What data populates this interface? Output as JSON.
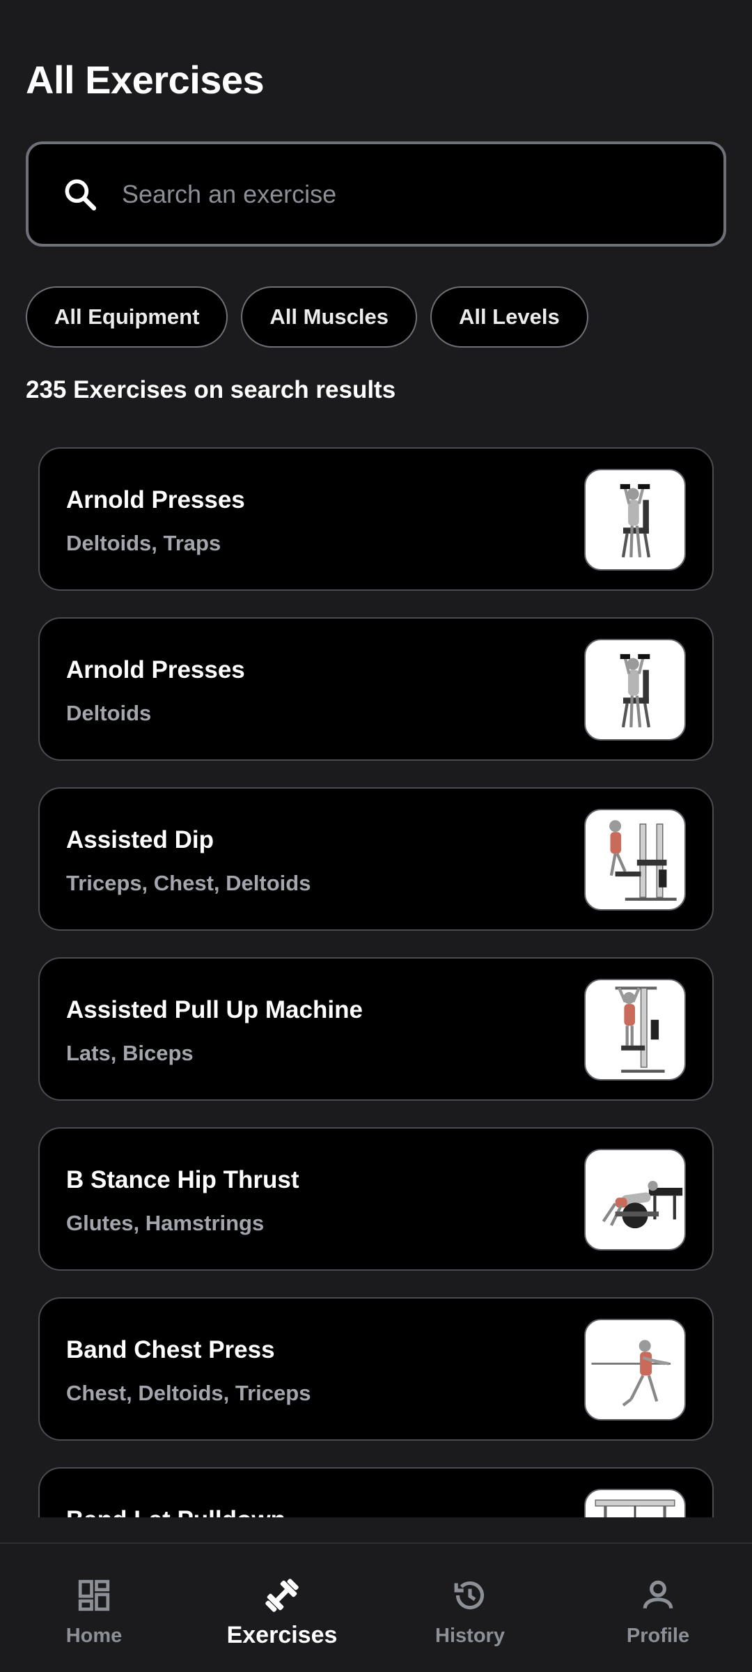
{
  "header": {
    "title": "All Exercises"
  },
  "search": {
    "placeholder": "Search an exercise",
    "value": ""
  },
  "filters": [
    {
      "label": "All Equipment"
    },
    {
      "label": "All Muscles"
    },
    {
      "label": "All Levels"
    }
  ],
  "results": {
    "summary": "235 Exercises on search results"
  },
  "exercises": [
    {
      "name": "Arnold Presses",
      "muscles": "Deltoids, Traps",
      "thumbnail_icon": "seated-dumbbell-press-figure"
    },
    {
      "name": "Arnold Presses",
      "muscles": "Deltoids",
      "thumbnail_icon": "seated-dumbbell-press-figure"
    },
    {
      "name": "Assisted Dip",
      "muscles": "Triceps, Chest, Deltoids",
      "thumbnail_icon": "dip-machine-figure"
    },
    {
      "name": "Assisted Pull Up Machine",
      "muscles": "Lats, Biceps",
      "thumbnail_icon": "pullup-machine-figure"
    },
    {
      "name": "B Stance Hip Thrust",
      "muscles": "Glutes, Hamstrings",
      "thumbnail_icon": "hip-thrust-figure"
    },
    {
      "name": "Band Chest Press",
      "muscles": "Chest, Deltoids, Triceps",
      "thumbnail_icon": "band-press-figure"
    },
    {
      "name": "Band Lat Pulldown",
      "muscles": "",
      "thumbnail_icon": "lat-pulldown-figure"
    }
  ],
  "nav": {
    "items": [
      {
        "label": "Home",
        "icon": "dashboard-icon",
        "active": false
      },
      {
        "label": "Exercises",
        "icon": "dumbbell-icon",
        "active": true
      },
      {
        "label": "History",
        "icon": "history-icon",
        "active": false
      },
      {
        "label": "Profile",
        "icon": "person-icon",
        "active": false
      }
    ]
  },
  "colors": {
    "background": "#1b1b1d",
    "card": "#000000",
    "border": "#6f7178",
    "muted_text": "#a4a6ad",
    "nav_inactive": "#8e9097"
  }
}
